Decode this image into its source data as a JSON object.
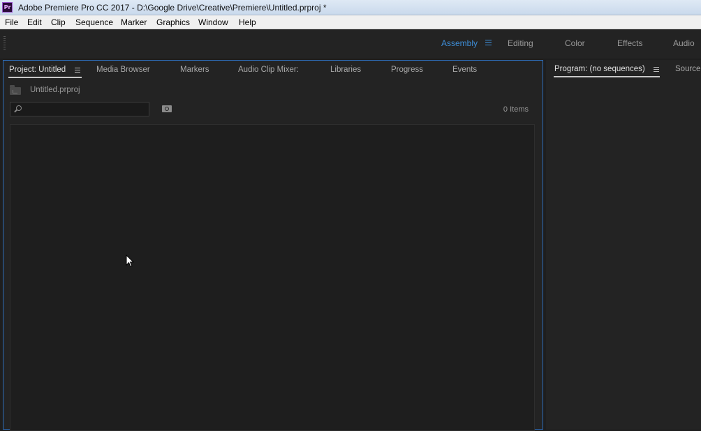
{
  "window": {
    "title": "Adobe Premiere Pro CC 2017 - D:\\Google Drive\\Creative\\Premiere\\Untitled.prproj *",
    "app_icon": "Pr"
  },
  "menu": [
    "File",
    "Edit",
    "Clip",
    "Sequence",
    "Marker",
    "Graphics",
    "Window",
    "Help"
  ],
  "workspaces": {
    "active": "Assembly",
    "items": [
      "Assembly",
      "Editing",
      "Color",
      "Effects",
      "Audio"
    ],
    "accent_color": "#3e8ed8"
  },
  "project_panel": {
    "tabs": [
      "Project: Untitled",
      "Media Browser",
      "Markers",
      "Audio Clip Mixer:",
      "Libraries",
      "Progress",
      "Events"
    ],
    "active_tab": "Project: Untitled",
    "project_file": "Untitled.prproj",
    "search": {
      "value": "",
      "placeholder": ""
    },
    "items_count": "0 Items"
  },
  "program_panel": {
    "tabs": [
      "Program: (no sequences)",
      "Source:"
    ],
    "active_tab": "Program: (no sequences)"
  }
}
